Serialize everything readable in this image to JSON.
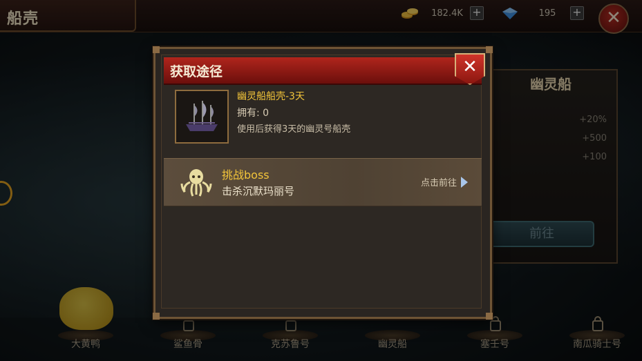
{
  "header": {
    "title": "船壳",
    "gold": "182.4K",
    "gems": "195",
    "close_symbol": "✕"
  },
  "right_panel": {
    "title": "幽灵船",
    "stats": [
      "+20%",
      "+500",
      "+100"
    ],
    "go_label": "前往"
  },
  "ships": [
    {
      "name": "大黄鸭"
    },
    {
      "name": "鲨鱼骨"
    },
    {
      "name": "克苏鲁号"
    },
    {
      "name": "幽灵船"
    },
    {
      "name": "塞壬号"
    },
    {
      "name": "南瓜骑士号"
    }
  ],
  "dialog": {
    "title": "获取途径",
    "close_symbol": "✕",
    "item": {
      "name": "幽灵船船壳-3天",
      "owned": "拥有: 0",
      "description": "使用后获得3天的幽灵号船壳"
    },
    "routes": [
      {
        "title": "挑战boss",
        "description": "击杀沉默玛丽号",
        "goto_label": "点击前往"
      }
    ]
  },
  "colors": {
    "highlight_gold": "#f3c53a",
    "header_red": "#b0251c",
    "frame_brown": "#6e5435"
  }
}
